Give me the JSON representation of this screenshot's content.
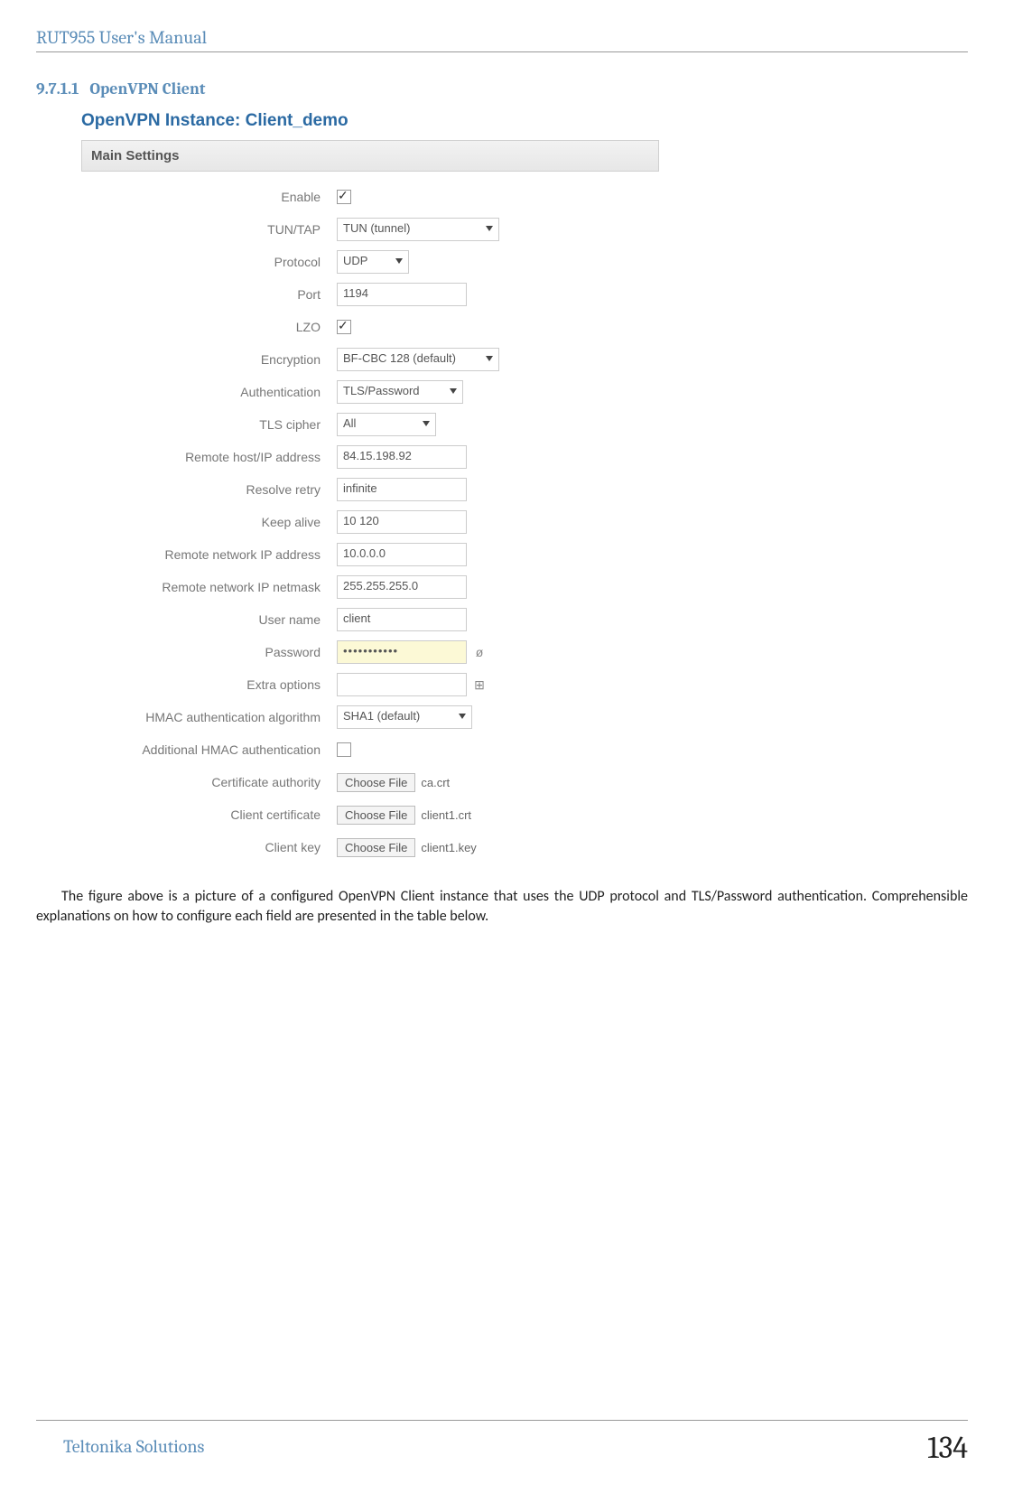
{
  "doc": {
    "header": "RUT955 User's Manual",
    "footer_left": "Teltonika Solutions",
    "page_number": "134"
  },
  "section": {
    "number": "9.7.1.1",
    "title": "OpenVPN Client"
  },
  "shot": {
    "title": "OpenVPN Instance: Client_demo",
    "panel": "Main Settings",
    "labels": {
      "enable": "Enable",
      "tuntap": "TUN/TAP",
      "protocol": "Protocol",
      "port": "Port",
      "lzo": "LZO",
      "encryption": "Encryption",
      "auth": "Authentication",
      "tls_cipher": "TLS cipher",
      "remote_host": "Remote host/IP address",
      "resolve_retry": "Resolve retry",
      "keep_alive": "Keep alive",
      "remote_net_ip": "Remote network IP address",
      "remote_net_mask": "Remote network IP netmask",
      "user": "User name",
      "password": "Password",
      "extra": "Extra options",
      "hmac_alg": "HMAC authentication algorithm",
      "add_hmac": "Additional HMAC authentication",
      "ca": "Certificate authority",
      "client_cert": "Client certificate",
      "client_key": "Client key"
    },
    "values": {
      "tuntap": "TUN (tunnel)",
      "protocol": "UDP",
      "port": "1194",
      "encryption": "BF-CBC 128 (default)",
      "auth": "TLS/Password",
      "tls_cipher": "All",
      "remote_host": "84.15.198.92",
      "resolve_retry": "infinite",
      "keep_alive": "10 120",
      "remote_net_ip": "10.0.0.0",
      "remote_net_mask": "255.255.255.0",
      "user": "client",
      "password": "•••••••••••",
      "extra": "",
      "hmac_alg": "SHA1 (default)",
      "choose_file": "Choose File",
      "ca_file": "ca.crt",
      "client_cert_file": "client1.crt",
      "client_key_file": "client1.key"
    }
  },
  "body": "The figure above is a picture of a configured OpenVPN Client instance that uses the UDP protocol and TLS/Password authentication. Comprehensible explanations on how to configure each field are presented in the table below."
}
